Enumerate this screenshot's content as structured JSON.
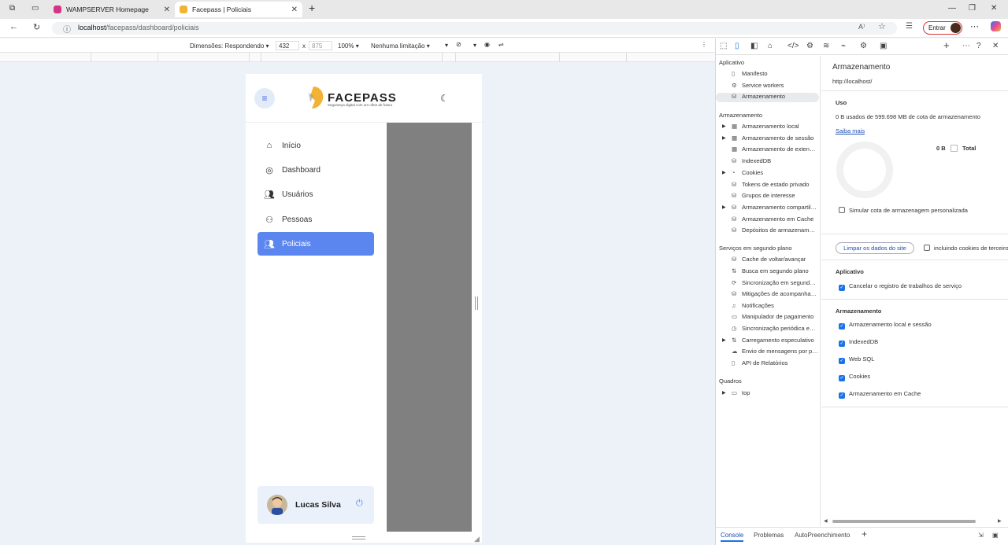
{
  "browser": {
    "tabs": [
      {
        "title": "WAMPSERVER Homepage",
        "icon": "wamp-icon",
        "active": false
      },
      {
        "title": "Facepass | Policiais",
        "icon": "facepass-icon",
        "active": true
      }
    ],
    "url_host": "localhost",
    "url_path": "/facepass/dashboard/policiais",
    "profile_button": "Entrar",
    "reader_label": "A⁾"
  },
  "device_toolbar": {
    "dimensions_label": "Dimensões: Respondendo",
    "width": "432",
    "times": "x",
    "height": "875",
    "zoom": "100%",
    "throttle": "Nenhuma limitação"
  },
  "app": {
    "brand": "FACEPASS",
    "tagline": "Segurança digital com um olhar de futuro",
    "menu": [
      {
        "label": "Início",
        "icon": "home-icon",
        "active": false
      },
      {
        "label": "Dashboard",
        "icon": "dashboard-icon",
        "active": false
      },
      {
        "label": "Usuários",
        "icon": "users-icon",
        "active": false
      },
      {
        "label": "Pessoas",
        "icon": "people-icon",
        "active": false
      },
      {
        "label": "Policiais",
        "icon": "police-icon",
        "active": true
      }
    ],
    "user_name": "Lucas Silva",
    "accent": "#5b86f0"
  },
  "devtools": {
    "sections": {
      "app": "Aplicativo",
      "storage": "Armazenamento",
      "background": "Serviços em segundo plano",
      "frames": "Quadros"
    },
    "app_items": [
      "Manifesto",
      "Service workers",
      "Armazenamento"
    ],
    "storage_items": [
      "Armazenamento local",
      "Armazenamento de sessão",
      "Armazenamento de extensão",
      "IndexedDB",
      "Cookies",
      "Tokens de estado privado",
      "Grupos de interesse",
      "Armazenamento compartilhado",
      "Armazenamento em Cache",
      "Depósitos de armazenamento"
    ],
    "background_items": [
      "Cache de voltar/avançar",
      "Busca em segundo plano",
      "Sincronização em segundo plano",
      "Mitigações de acompanhamento",
      "Notificações",
      "Manipulador de pagamento",
      "Sincronização periódica em segundo plano",
      "Carregamento especulativo",
      "Envio de mensagens por push",
      "API de Relatórios"
    ],
    "frames_items": [
      "top"
    ],
    "panel": {
      "title": "Armazenamento",
      "origin": "http://localhost/",
      "usage_heading": "Uso",
      "usage_text": "0 B usados de 599.698 MB de cota de armazenamento",
      "learn_more": "Saiba mais",
      "total_value": "0 B",
      "total_label": "Total",
      "simulate_label": "Simular cota de armazenagem personalizada",
      "clear_button": "Limpar os dados do site",
      "include_cookies": "incluindo cookies de terceiros",
      "app_heading": "Aplicativo",
      "app_checks": [
        "Cancelar o registro de trabalhos de serviço"
      ],
      "storage_heading": "Armazenamento",
      "storage_checks": [
        "Armazenamento local e sessão",
        "IndexedDB",
        "Web SQL",
        "Cookies",
        "Armazenamento em Cache"
      ]
    },
    "drawer_tabs": [
      "Console",
      "Problemas",
      "AutoPreenchimento"
    ]
  }
}
